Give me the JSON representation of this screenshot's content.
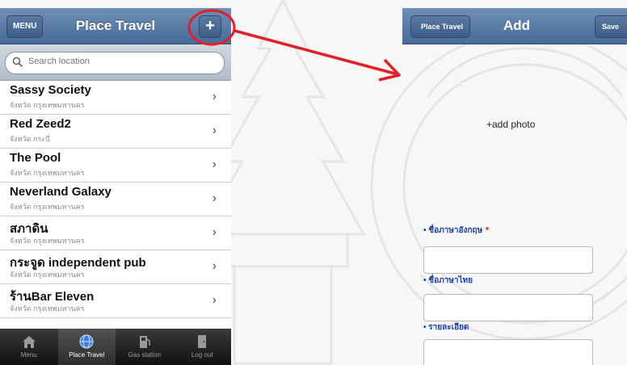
{
  "left_screen": {
    "menu_button": "MENU",
    "title": "Place Travel",
    "add_button": "+",
    "search": {
      "placeholder": "Search location"
    },
    "places": [
      {
        "name": "Sassy  Society",
        "province": "จังหวัด กรุงเทพมหานคร"
      },
      {
        "name": "Red Zeed2",
        "province": "จังหวัด กระบี่"
      },
      {
        "name": "The Pool",
        "province": "จังหวัด กรุงเทพมหานคร"
      },
      {
        "name": "Neverland Galaxy",
        "province": "จังหวัด กรุงเทพมหานคร"
      },
      {
        "name": "สภาดิน",
        "province": "จังหวัด กรุงเทพมหานคร"
      },
      {
        "name": "กระจูด independent pub",
        "province": "จังหวัด กรุงเทพมหานคร"
      },
      {
        "name": "ร้านBar Eleven",
        "province": "จังหวัด กรุงเทพมหานคร"
      }
    ],
    "tabs": [
      {
        "label": "Menu",
        "icon": "home-icon"
      },
      {
        "label": "Place Travel",
        "icon": "globe-icon"
      },
      {
        "label": "Gas station",
        "icon": "gas-pump-icon"
      },
      {
        "label": "Log out",
        "icon": "door-icon"
      }
    ]
  },
  "right_screen": {
    "back_button": "Place Travel",
    "title": "Add",
    "save_button": "Save",
    "add_photo": "+add photo",
    "fields": [
      {
        "label": "ชื่อภาษาอังกฤษ",
        "required_mark": "*"
      },
      {
        "label": "ชื่อภาษาไทย",
        "required_mark": ""
      },
      {
        "label": "รายละเอียด",
        "required_mark": ""
      }
    ]
  },
  "colors": {
    "navbar": "#5a7aa6",
    "annotation_red": "#e0202a",
    "field_label_blue": "#1a3fa8"
  }
}
